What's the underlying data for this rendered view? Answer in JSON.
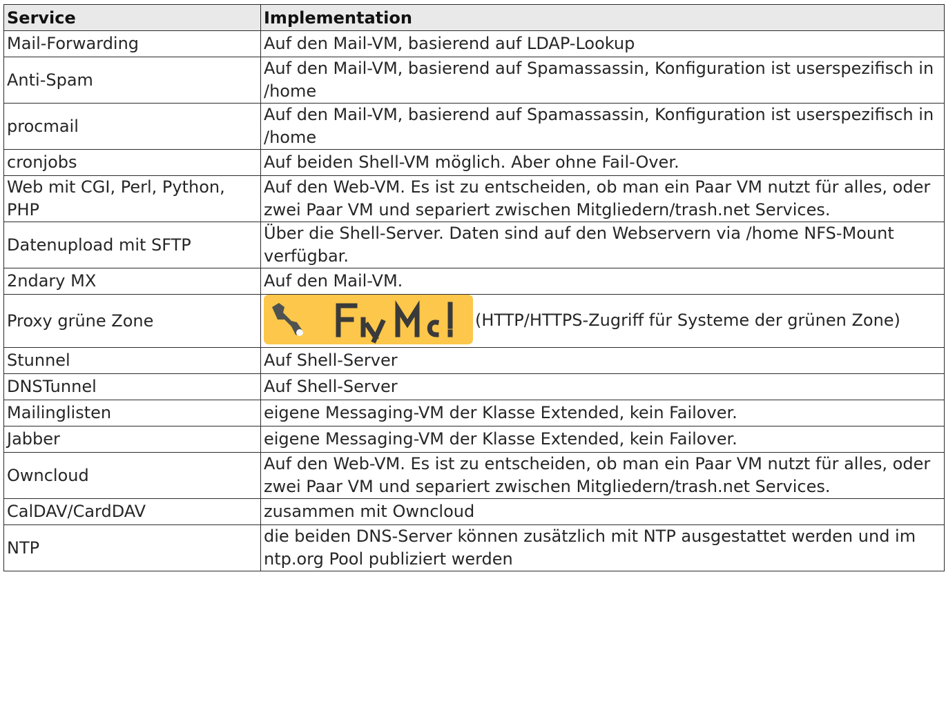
{
  "table": {
    "headers": {
      "service": "Service",
      "implementation": "Implementation"
    },
    "rows": [
      {
        "service": "Mail-Forwarding",
        "implementation": "Auf den Mail-VM, basierend auf LDAP-Lookup"
      },
      {
        "service": "Anti-Spam",
        "implementation": "Auf den Mail-VM, basierend auf Spamassassin, Konfiguration ist userspezifisch in /home"
      },
      {
        "service": "procmail",
        "implementation": "Auf den Mail-VM, basierend auf Spamassassin, Konfiguration ist userspezifisch in /home"
      },
      {
        "service": "cronjobs",
        "implementation": "Auf beiden Shell-VM möglich. Aber ohne Fail-Over."
      },
      {
        "service": "Web mit CGI, Perl, Python, PHP",
        "implementation": "Auf den Web-VM. Es ist zu entscheiden, ob man ein Paar VM nutzt für alles, oder zwei Paar VM und separiert zwischen Mitgliedern/trash.net Services."
      },
      {
        "service": "Datenupload mit SFTP",
        "implementation": "Über die Shell-Server. Daten sind auf den Webservern via /home NFS-Mount verfügbar."
      },
      {
        "service": "2ndary MX",
        "implementation": "Auf den Mail-VM."
      },
      {
        "service": "Proxy grüne Zone",
        "implementation": "(HTTP/HTTPS-Zugriff für Systeme der grünen Zone)",
        "badge": {
          "text": "FIXME",
          "icon": "wrench-icon",
          "color": "#fcc74a"
        }
      },
      {
        "service": "Stunnel",
        "implementation": "Auf Shell-Server"
      },
      {
        "service": "DNSTunnel",
        "implementation": "Auf Shell-Server"
      },
      {
        "service": "Mailinglisten",
        "implementation": "eigene Messaging-VM der Klasse Extended, kein Failover."
      },
      {
        "service": "Jabber",
        "implementation": "eigene Messaging-VM der Klasse Extended, kein Failover."
      },
      {
        "service": "Owncloud",
        "implementation": "Auf den Web-VM. Es ist zu entscheiden, ob man ein Paar VM nutzt für alles, oder zwei Paar VM und separiert zwischen Mitgliedern/trash.net Services."
      },
      {
        "service": "CalDAV/CardDAV",
        "implementation": "zusammen mit Owncloud"
      },
      {
        "service": "NTP",
        "implementation": "die beiden DNS-Server können zusätzlich mit NTP ausgestattet werden und im ntp.org Pool publiziert werden"
      }
    ]
  }
}
